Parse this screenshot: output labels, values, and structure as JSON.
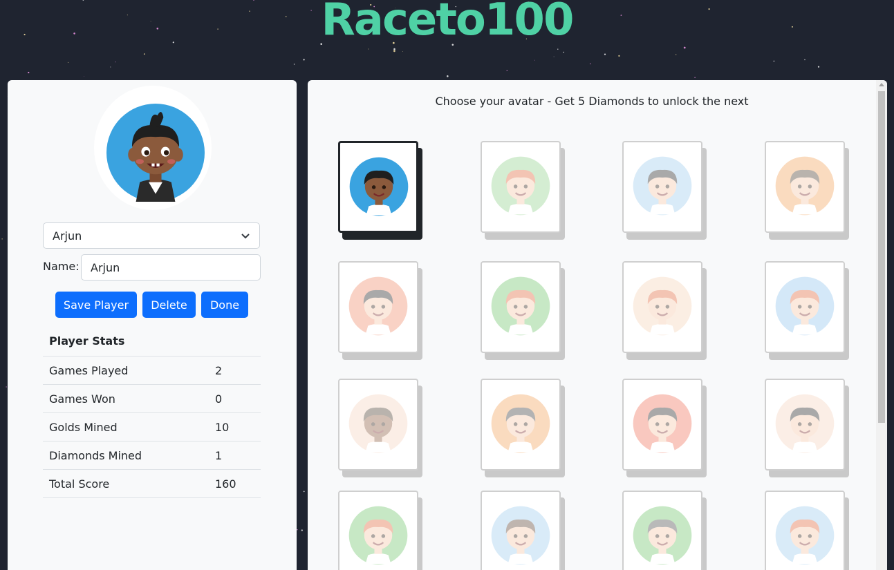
{
  "app": {
    "title": "Raceto100"
  },
  "player": {
    "selected": "Arjun",
    "name_label": "Name:",
    "name_value": "Arjun"
  },
  "buttons": {
    "save": "Save Player",
    "delete": "Delete",
    "done": "Done"
  },
  "stats": {
    "heading": "Player Stats",
    "rows": [
      {
        "label": "Games Played",
        "value": "2"
      },
      {
        "label": "Games Won",
        "value": "0"
      },
      {
        "label": "Golds Mined",
        "value": "10"
      },
      {
        "label": "Diamonds Mined",
        "value": "1"
      },
      {
        "label": "Total Score",
        "value": "160"
      }
    ]
  },
  "avatars": {
    "heading": "Choose your avatar - Get 5 Diamonds to unlock the next",
    "items": [
      {
        "bg": "#3aa3e0",
        "hair": "#1f1f1f",
        "skin": "#8b5a3c",
        "state": "selected"
      },
      {
        "bg": "#8fd18a",
        "hair": "#e0663a",
        "skin": "#f5c8a8",
        "state": "locked"
      },
      {
        "bg": "#9ccbee",
        "hair": "#1f1f1f",
        "skin": "#f5c8a8",
        "state": "locked"
      },
      {
        "bg": "#f3a25a",
        "hair": "#4a3a2a",
        "skin": "#f5c8a8",
        "state": "locked"
      },
      {
        "bg": "#f08a6a",
        "hair": "#1f1f1f",
        "skin": "#f5c8a8",
        "state": "locked"
      },
      {
        "bg": "#6fc46a",
        "hair": "#e0663a",
        "skin": "#f5c8a8",
        "state": "locked"
      },
      {
        "bg": "#f7d5b8",
        "hair": "#e0663a",
        "skin": "#f5c8a8",
        "state": "locked"
      },
      {
        "bg": "#8fc3ee",
        "hair": "#e0663a",
        "skin": "#f5c8a8",
        "state": "locked"
      },
      {
        "bg": "#f7d5c0",
        "hair": "#4a3a2a",
        "skin": "#8b5a3c",
        "state": "locked"
      },
      {
        "bg": "#f3a25a",
        "hair": "#3a3a3a",
        "skin": "#f5c8a8",
        "state": "locked"
      },
      {
        "bg": "#f0705a",
        "hair": "#1f1f1f",
        "skin": "#f5c8a8",
        "state": "locked"
      },
      {
        "bg": "#f7d5c0",
        "hair": "#1f1f1f",
        "skin": "#f5c8a8",
        "state": "locked"
      },
      {
        "bg": "#6fc46a",
        "hair": "#e0663a",
        "skin": "#f5c8a8",
        "state": "locked"
      },
      {
        "bg": "#9ccbee",
        "hair": "#5a4030",
        "skin": "#f5c8a8",
        "state": "locked"
      },
      {
        "bg": "#6fc46a",
        "hair": "#4a4a4a",
        "skin": "#f5c8a8",
        "state": "locked"
      },
      {
        "bg": "#9ccbee",
        "hair": "#e0663a",
        "skin": "#f5c8a8",
        "state": "locked"
      }
    ]
  },
  "colors": {
    "accent": "#0d6efd",
    "title": "#4fd1a5",
    "background": "#1f2430"
  }
}
